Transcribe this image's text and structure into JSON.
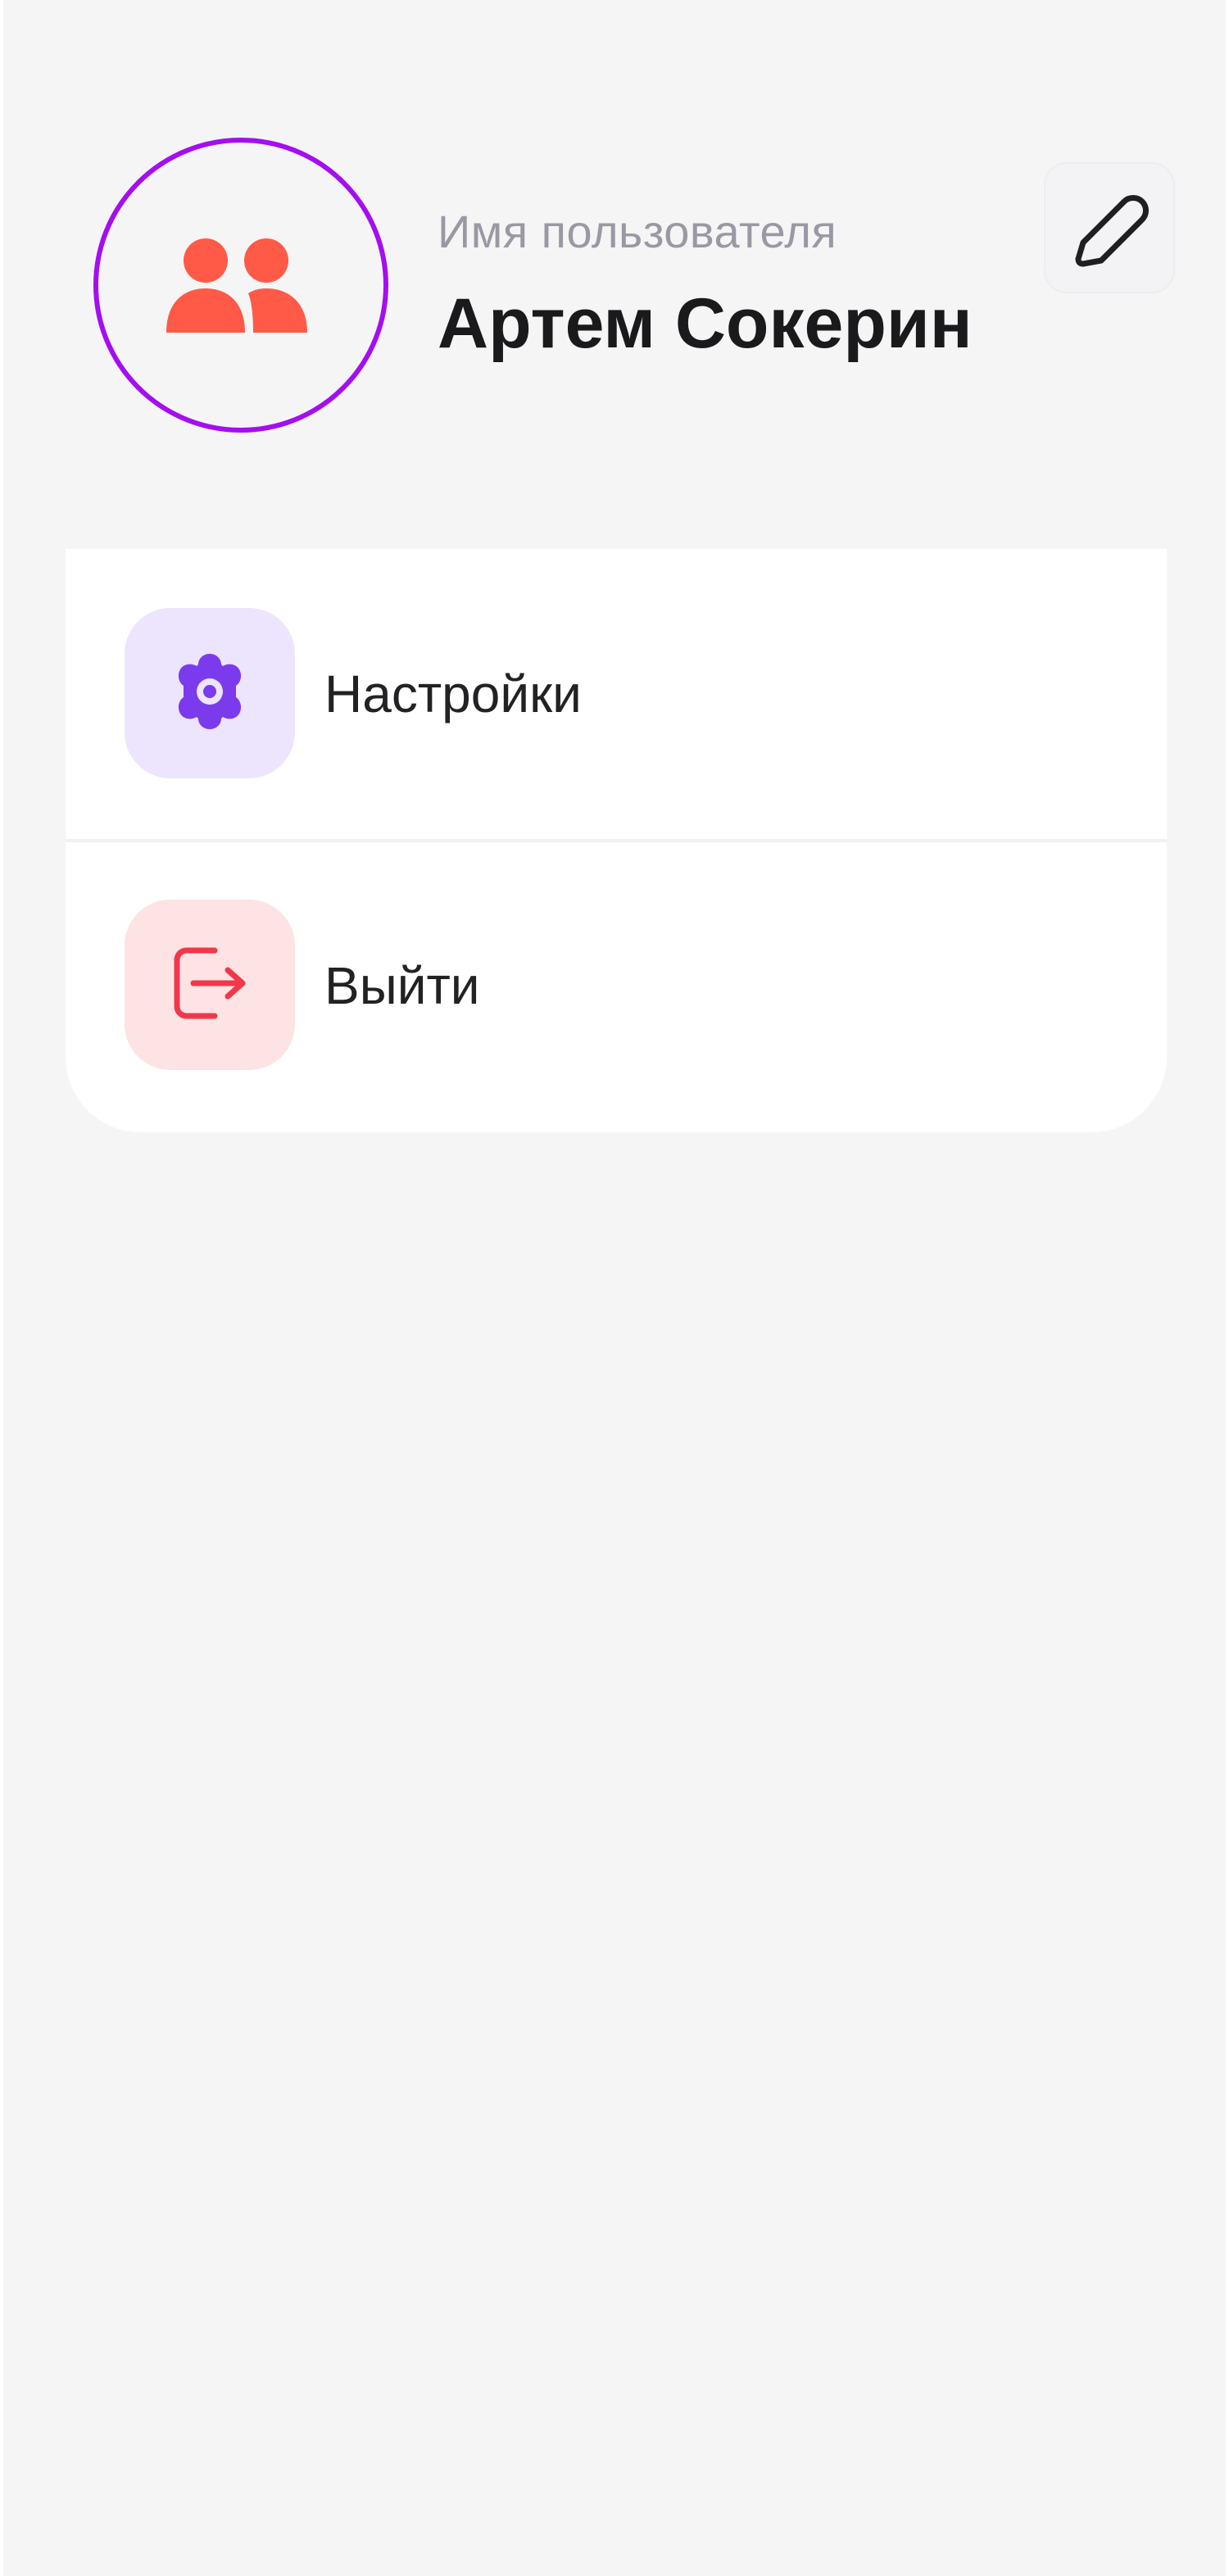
{
  "profile": {
    "username_label": "Имя пользователя",
    "username": "Артем Сокерин",
    "avatar_icon": "users-icon",
    "edit_icon": "pencil-icon"
  },
  "menu": {
    "items": [
      {
        "label": "Настройки",
        "icon": "gear-icon",
        "icon_color": "#7c3aed",
        "icon_bg": "#ede5fd"
      },
      {
        "label": "Выйти",
        "icon": "logout-icon",
        "icon_color": "#f0384b",
        "icon_bg": "#fde3e3"
      }
    ]
  },
  "colors": {
    "avatar_ring": "#a40ef0",
    "avatar_icon": "#ff5a47",
    "background": "#f5f5f6"
  }
}
